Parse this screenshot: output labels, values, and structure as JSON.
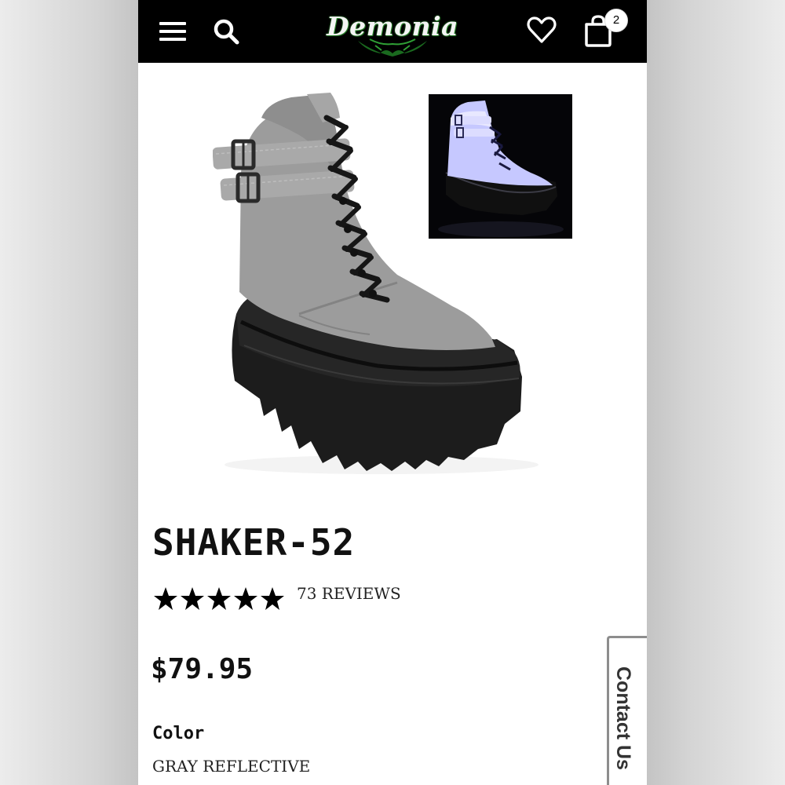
{
  "header": {
    "logo_text": "Demonia",
    "cart_count": "2",
    "accent_color": "#3fae3f"
  },
  "icons": [
    "menu-icon",
    "search-icon",
    "heart-icon",
    "shopping-bag-icon",
    "star-icon"
  ],
  "product": {
    "title": "SHAKER-52",
    "rating": 5,
    "reviews_label": "73 REVIEWS",
    "price": "$79.95",
    "color_label": "Color",
    "color_value": "GRAY REFLECTIVE"
  },
  "contact": {
    "label": "Contact Us"
  }
}
